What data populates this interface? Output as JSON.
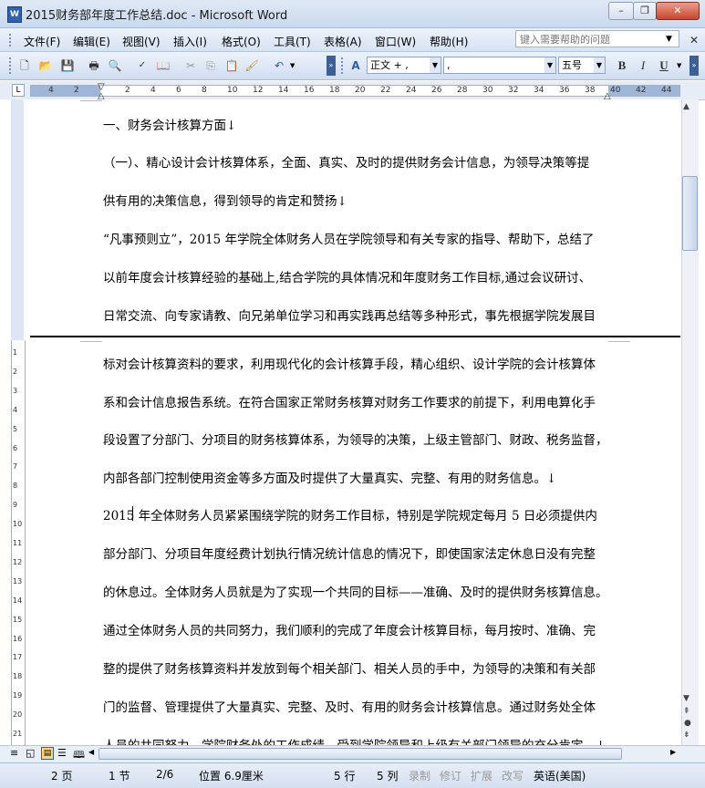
{
  "window": {
    "title": "2015财务部年度工作总结.doc - Microsoft Word",
    "min": "–",
    "max": "❐",
    "close": "✕"
  },
  "menu": [
    "文件(F)",
    "编辑(E)",
    "视图(V)",
    "插入(I)",
    "格式(O)",
    "工具(T)",
    "表格(A)",
    "窗口(W)",
    "帮助(H)"
  ],
  "help_placeholder": "键入需要帮助的问题",
  "toolbar": {
    "style": "正文 + ,",
    "font": ",",
    "size": "五号",
    "bold": "B",
    "italic": "I",
    "underline": "U"
  },
  "ruler_numbers": [
    "4",
    "2",
    "2",
    "4",
    "6",
    "8",
    "10",
    "12",
    "14",
    "16",
    "18",
    "20",
    "22",
    "24",
    "26",
    "28",
    "30",
    "32",
    "34",
    "36",
    "38",
    "40",
    "42",
    "44"
  ],
  "vruler_numbers": [
    "1",
    "2",
    "3",
    "4",
    "5",
    "6",
    "7",
    "8",
    "9",
    "10",
    "11",
    "12",
    "13",
    "14",
    "15",
    "16",
    "17",
    "18",
    "19",
    "20",
    "21"
  ],
  "document": {
    "lines": [
      "一、财务会计核算方面↓",
      "（一）、精心设计会计核算体系，全面、真实、及时的提供财务会计信息，为领导决策等提",
      "供有用的决策信息，得到领导的肯定和赞扬↓",
      "“凡事预则立”，2015 年学院全体财务人员在学院领导和有关专家的指导、帮助下，总结了",
      "以前年度会计核算经验的基础上,结合学院的具体情况和年度财务工作目标,通过会议研讨、",
      "日常交流、向专家请教、向兄弟单位学习和再实践再总结等多种形式，事先根据学院发展目",
      "标对会计核算资料的要求，利用现代化的会计核算手段，精心组织、设计学院的会计核算体",
      "系和会计信息报告系统。在符合国家正常财务核算对财务工作要求的前提下，利用电算化手",
      "段设置了分部门、分项目的财务核算体系，为领导的决策，上级主管部门、财政、税务监督，",
      "内部各部门控制使用资金等多方面及时提供了大量真实、完整、有用的财务信息。↓",
      "2015 年全体财务人员紧紧围绕学院的财务工作目标，特别是学院规定每月 5 日必须提供内",
      "部分部门、分项目年度经费计划执行情况统计信息的情况下，即使国家法定休息日没有完整",
      "的休息过。全体财务人员就是为了实现一个共同的目标——准确、及时的提供财务核算信息。",
      "通过全体财务人员的共同努力，我们顺利的完成了年度会计核算目标，每月按时、准确、完",
      "整的提供了财务核算资料并发放到每个相关部门、相关人员的手中，为领导的决策和有关部",
      "门的监督、管理提供了大量真实、完整、及时、有用的财务会计核算信息。通过财务处全体",
      "人员的共同努力，学院财务处的工作成绩，受到学院领导和上级有关部门领导的充分肯定。↓"
    ]
  },
  "status": {
    "page": "2 页",
    "section": "1 节",
    "pages": "2/6",
    "position": "位置 6.9厘米",
    "line": "5 行",
    "col": "5 列",
    "rec": "录制",
    "trk": "修订",
    "ext": "扩展",
    "ovr": "改写",
    "lang": "英语(美国)"
  }
}
